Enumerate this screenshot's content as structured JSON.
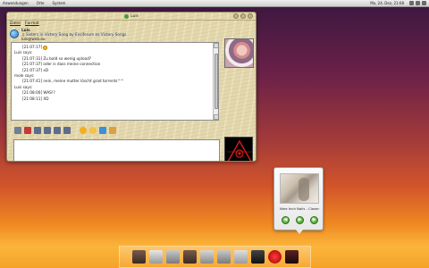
{
  "top_panel": {
    "menus": [
      "Anwendungen",
      "Orte",
      "System"
    ],
    "clock": "Mo, 24. Dez, 21:08"
  },
  "chat_window": {
    "title": "Luis",
    "menu": [
      "Datei",
      "Format"
    ],
    "contact": {
      "name": "Luis",
      "song": "♫ Sisters in Victory Song by Ensiferum ex Victory Songs",
      "email": "luis@web.eu"
    },
    "messages": [
      {
        "type": "msg",
        "text": "[21:07:17]"
      },
      {
        "type": "says",
        "text": "Luis says:"
      },
      {
        "type": "msg",
        "text": "[21:07:31] Zu bald so wenig upload?"
      },
      {
        "type": "msg",
        "text": "[21:07:37] oder is dass meine connection"
      },
      {
        "type": "msg",
        "text": "[21:07:37] xD"
      },
      {
        "type": "says",
        "text": "mole says:"
      },
      {
        "type": "msg",
        "text": "[21:07:41] nein, meine mutter löscht grad torrents^^"
      },
      {
        "type": "says",
        "text": "Luis says:"
      },
      {
        "type": "msg",
        "text": "[21:08:00] WAS!?"
      },
      {
        "type": "msg",
        "text": "[21:08:11] XD"
      }
    ],
    "input_value": ""
  },
  "toolbar_icons": [
    "font-icon",
    "color-icon",
    "bold-icon",
    "italic-icon",
    "underline-icon",
    "strike-icon",
    "smiley-icon",
    "wink-icon",
    "nudge-icon",
    "wizz-icon"
  ],
  "music_popup": {
    "track": "Nine Inch Nails - Closer",
    "controls": {
      "prev": "◀",
      "play": "▶",
      "next": "▶"
    }
  },
  "dock_icons": [
    "app-1-icon",
    "app-2-icon",
    "app-3-icon",
    "app-4-icon",
    "app-5-icon",
    "app-6-icon",
    "app-7-icon",
    "app-8-icon",
    "app-9-icon",
    "app-10-icon"
  ],
  "colors": {
    "window_wood": "#e3d7ad",
    "accent_green": "#3c8f24",
    "link_blue": "#1a3f8f"
  }
}
